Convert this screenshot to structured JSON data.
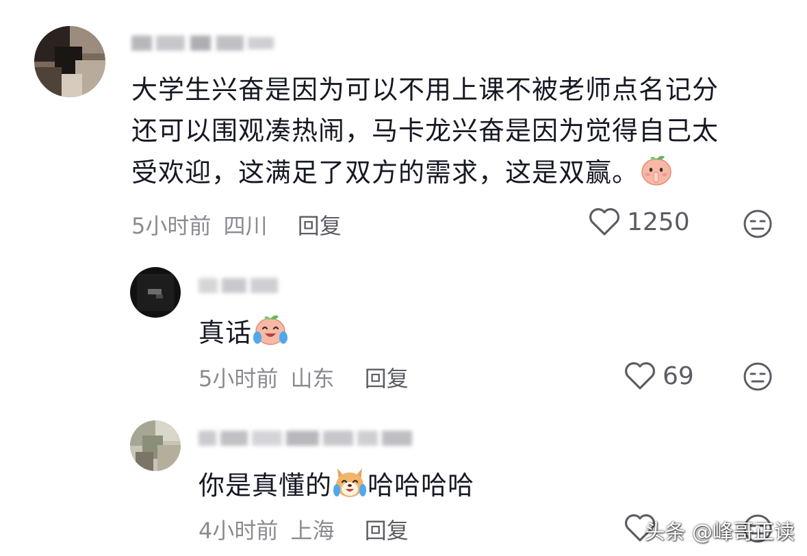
{
  "comments": [
    {
      "text_lines": [
        "大学生兴奋是因为可以不用上课不被老师点名记分",
        "还可以围观凑热闹，马卡龙兴奋是因为觉得自己太",
        "受欢迎，这满足了双方的需求，这是双赢。"
      ],
      "time": "5小时前",
      "location": "四川",
      "reply_label": "回复",
      "likes": "1250",
      "emoji": "shush-peach-emoji"
    },
    {
      "text": "真话",
      "time": "5小时前",
      "location": "山东",
      "reply_label": "回复",
      "likes": "69",
      "emoji": "crying-laugh-peach-emoji"
    },
    {
      "text_before": "你是真懂的",
      "text_after": "哈哈哈哈",
      "time": "4小时前",
      "location": "上海",
      "reply_label": "回复",
      "emoji": "crying-laugh-dog-emoji"
    }
  ],
  "watermark": "头条 @峰哥正读",
  "colors": {
    "text": "#161823",
    "meta": "#8a8b91",
    "icon": "#5b5c63"
  }
}
